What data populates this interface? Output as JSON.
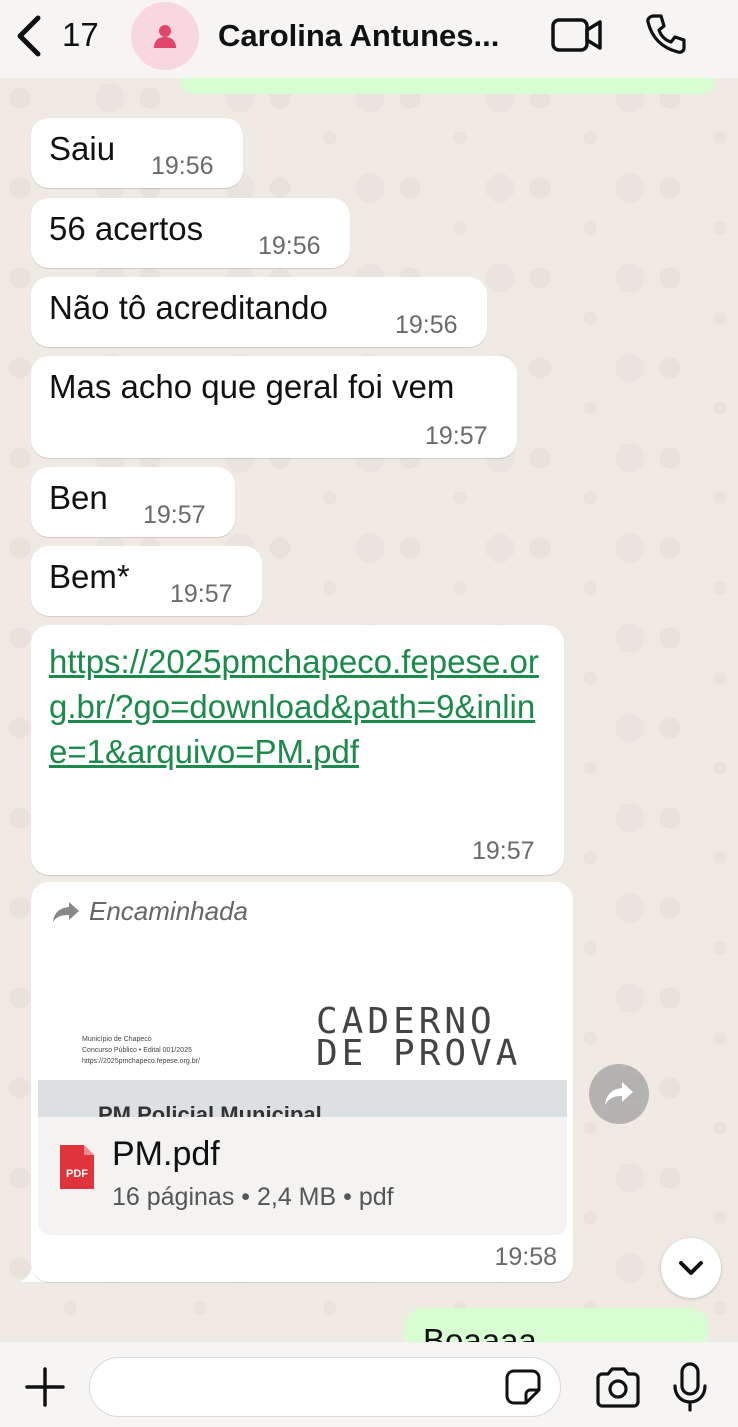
{
  "header": {
    "back_count": "17",
    "contact_name": "Carolina Antunes..."
  },
  "messages": [
    {
      "text": "Saiu",
      "time": "19:56"
    },
    {
      "text": "56 acertos",
      "time": "19:56"
    },
    {
      "text": "Não tô acreditando",
      "time": "19:56"
    },
    {
      "text": "Mas acho que geral foi vem",
      "time": "19:57"
    },
    {
      "text": "Ben",
      "time": "19:57"
    },
    {
      "text": "Bem*",
      "time": "19:57"
    },
    {
      "text": "https://2025pmchapeco.fepese.org.br/?go=download&path=9&inline=1&arquivo=PM.pdf",
      "time": "19:57"
    }
  ],
  "document": {
    "forwarded_label": "Encaminhada",
    "preview_title_line1": "CADERNO",
    "preview_title_line2": "DE PROVA",
    "preview_small_1": "Município de Chapecó",
    "preview_small_2": "Concurso Público • Edital 001/2025",
    "preview_small_3": "https://2025pmchapeco.fepese.org.br/",
    "preview_cut_text": "PM   Policial Municipal",
    "file_name": "PM.pdf",
    "file_meta": "16 páginas • 2,4 MB • pdf",
    "pdf_badge": "PDF",
    "time": "19:58"
  },
  "outgoing_partial": "Boaaaa",
  "footer": {
    "input_value": "",
    "input_placeholder": ""
  },
  "colors": {
    "incoming_bubble": "#ffffff",
    "outgoing_bubble": "#d9fdd3",
    "link": "#1b8a4a",
    "background": "#efeae2",
    "pdf_red": "#e0343c",
    "avatar_bg": "#f8d8e0",
    "avatar_icon": "#e0456a"
  }
}
